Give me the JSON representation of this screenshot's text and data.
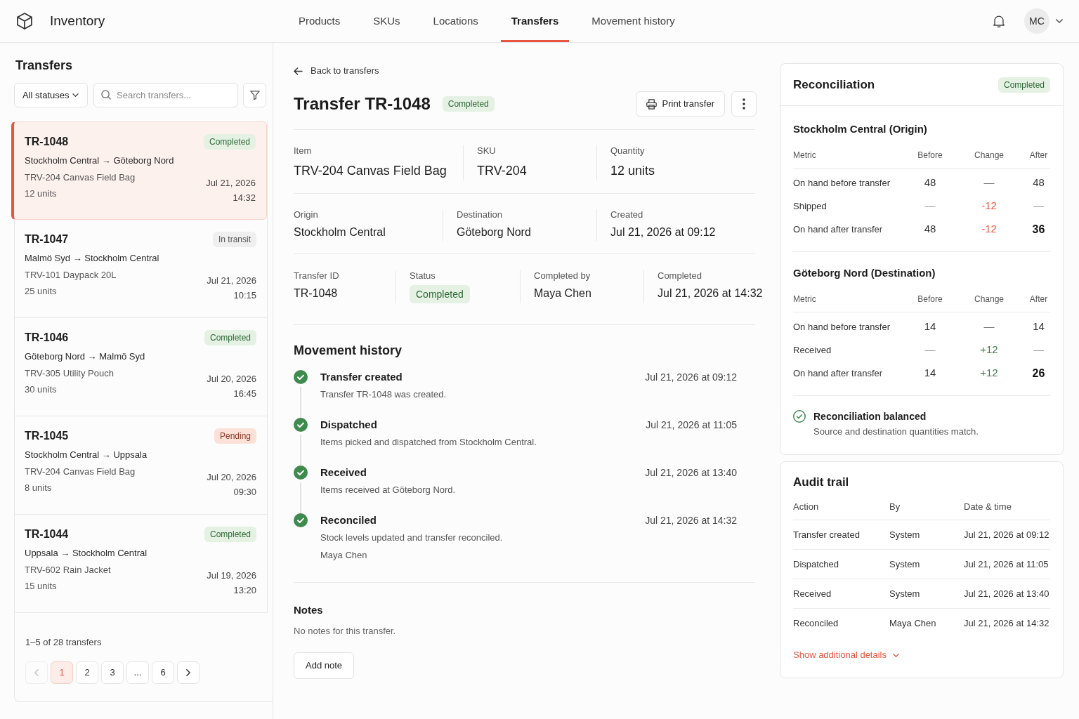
{
  "app": {
    "title": "Inventory"
  },
  "nav": {
    "tabs": [
      {
        "label": "Products",
        "selected": false
      },
      {
        "label": "SKUs",
        "selected": false
      },
      {
        "label": "Locations",
        "selected": false
      },
      {
        "label": "Transfers",
        "selected": true
      },
      {
        "label": "Movement history",
        "selected": false
      }
    ],
    "avatar": "MC"
  },
  "sidebar": {
    "title": "Transfers",
    "status_filter": "All statuses",
    "search": {
      "placeholder": "Search transfers..."
    },
    "transfers": [
      {
        "id": "TR-1048",
        "status": {
          "label": "Completed",
          "kind": "completed"
        },
        "route": "Stockholm Central → Göteborg Nord",
        "item": "TRV-204 Canvas Field Bag",
        "quantity": "12 units",
        "date": "Jul 21, 2026",
        "time": "14:32",
        "selected": true
      },
      {
        "id": "TR-1047",
        "status": {
          "label": "In transit",
          "kind": "in_transit"
        },
        "route": "Malmö Syd → Stockholm Central",
        "item": "TRV-101 Daypack 20L",
        "quantity": "25 units",
        "date": "Jul 21, 2026",
        "time": "10:15",
        "selected": false
      },
      {
        "id": "TR-1046",
        "status": {
          "label": "Completed",
          "kind": "completed"
        },
        "route": "Göteborg Nord → Malmö Syd",
        "item": "TRV-305 Utility Pouch",
        "quantity": "30 units",
        "date": "Jul 20, 2026",
        "time": "16:45",
        "selected": false
      },
      {
        "id": "TR-1045",
        "status": {
          "label": "Pending",
          "kind": "pending"
        },
        "route": "Stockholm Central → Uppsala",
        "item": "TRV-204 Canvas Field Bag",
        "quantity": "8 units",
        "date": "Jul 20, 2026",
        "time": "09:30",
        "selected": false
      },
      {
        "id": "TR-1044",
        "status": {
          "label": "Completed",
          "kind": "completed"
        },
        "route": "Uppsala → Stockholm Central",
        "item": "TRV-602 Rain Jacket",
        "quantity": "15 units",
        "date": "Jul 19, 2026",
        "time": "13:20",
        "selected": false
      }
    ],
    "pagination": {
      "summary": "1–5 of 28 transfers",
      "previous": {
        "disabled": true
      },
      "pages": [
        {
          "label": "1",
          "selected": true
        },
        {
          "label": "2",
          "selected": false
        },
        {
          "label": "3",
          "selected": false
        },
        {
          "label": "...",
          "selected": false
        },
        {
          "label": "6",
          "selected": false
        }
      ],
      "next": {
        "disabled": false
      }
    }
  },
  "detail": {
    "back_link": "Back to transfers",
    "title": "Transfer TR-1048",
    "status": {
      "label": "Completed",
      "kind": "completed"
    },
    "print_button": "Print transfer",
    "field_groups": [
      {
        "fields": [
          {
            "label": "Item",
            "kind": "text",
            "value": "TRV-204 Canvas Field Bag"
          },
          {
            "label": "SKU",
            "kind": "text",
            "value": "TRV-204"
          },
          {
            "label": "Quantity",
            "kind": "text",
            "value": "12 units"
          }
        ]
      },
      {
        "fields": [
          {
            "label": "Origin",
            "kind": "text",
            "value": "Stockholm Central"
          },
          {
            "label": "Destination",
            "kind": "text",
            "value": "Göteborg Nord"
          },
          {
            "label": "Created",
            "kind": "text",
            "value": "Jul 21, 2026 at 09:12"
          }
        ]
      },
      {
        "fields": [
          {
            "label": "Transfer ID",
            "kind": "text",
            "value": "TR-1048"
          },
          {
            "label": "Status",
            "kind": "status",
            "status": {
              "label": "Completed",
              "kind": "completed"
            }
          },
          {
            "label": "Completed by",
            "kind": "text",
            "value": "Maya Chen"
          },
          {
            "label": "Completed",
            "kind": "text",
            "value": "Jul 21, 2026 at 14:32"
          }
        ]
      }
    ],
    "movement_history": {
      "title": "Movement history",
      "events": [
        {
          "title": "Transfer created",
          "description": "Transfer TR-1048 was created.",
          "time": "Jul 21, 2026 at 09:12",
          "done": true
        },
        {
          "title": "Dispatched",
          "description": "Items picked and dispatched from Stockholm Central.",
          "time": "Jul 21, 2026 at 11:05",
          "done": true
        },
        {
          "title": "Received",
          "description": "Items received at Göteborg Nord.",
          "time": "Jul 21, 2026 at 13:40",
          "done": true
        },
        {
          "title": "Reconciled",
          "description": "Stock levels updated and transfer reconciled.",
          "actor": "Maya Chen",
          "time": "Jul 21, 2026 at 14:32",
          "done": true
        }
      ]
    },
    "notes": {
      "title": "Notes",
      "empty_text": "No notes for this transfer.",
      "add_button": "Add note"
    }
  },
  "reconciliation": {
    "title": "Reconciliation",
    "status": {
      "label": "Completed",
      "kind": "completed"
    },
    "sections": [
      {
        "title": "Stockholm Central (Origin)",
        "columns": [
          "Metric",
          "Before",
          "Change",
          "After"
        ],
        "rows": [
          {
            "metric": "On hand before transfer",
            "before": "48",
            "change": "—",
            "decrease": false,
            "increase": false,
            "after": "48",
            "kind": "balance"
          },
          {
            "metric": "Shipped",
            "before": "—",
            "change": "-12",
            "decrease": true,
            "increase": false,
            "after": "—",
            "kind": "movement"
          },
          {
            "metric": "On hand after transfer",
            "before": "48",
            "change": "-12",
            "decrease": true,
            "increase": false,
            "after": "36",
            "kind": "total"
          }
        ]
      },
      {
        "title": "Göteborg Nord (Destination)",
        "columns": [
          "Metric",
          "Before",
          "Change",
          "After"
        ],
        "rows": [
          {
            "metric": "On hand before transfer",
            "before": "14",
            "change": "—",
            "decrease": false,
            "increase": false,
            "after": "14",
            "kind": "balance"
          },
          {
            "metric": "Received",
            "before": "—",
            "change": "+12",
            "decrease": false,
            "increase": true,
            "after": "—",
            "kind": "movement"
          },
          {
            "metric": "On hand after transfer",
            "before": "14",
            "change": "+12",
            "decrease": false,
            "increase": true,
            "after": "26",
            "kind": "total"
          }
        ]
      }
    ],
    "summary": {
      "title": "Reconciliation balanced",
      "text": "Source and destination quantities match."
    }
  },
  "audit_trail": {
    "title": "Audit trail",
    "columns": [
      "Action",
      "By",
      "Date & time"
    ],
    "rows": [
      {
        "action": "Transfer created",
        "by": "System",
        "time": "Jul 21, 2026 at 09:12"
      },
      {
        "action": "Dispatched",
        "by": "System",
        "time": "Jul 21, 2026 at 11:05"
      },
      {
        "action": "Received",
        "by": "System",
        "time": "Jul 21, 2026 at 13:40"
      },
      {
        "action": "Reconciled",
        "by": "Maya Chen",
        "time": "Jul 21, 2026 at 14:32"
      }
    ],
    "more_link": "Show additional details"
  }
}
